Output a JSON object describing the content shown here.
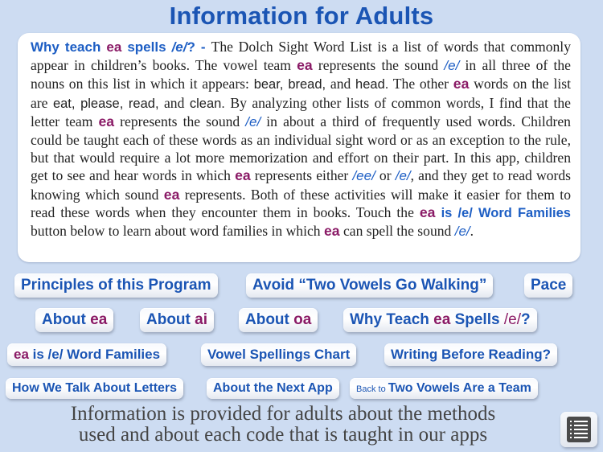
{
  "header": {
    "title": "Information for Adults"
  },
  "article": {
    "lead_a": "Why teach ",
    "lead_ea": "ea",
    "lead_b": " spells ",
    "lead_phon": "/e/",
    "lead_c": "? - ",
    "s1": "The Dolch Sight Word List is a list of words that commonly appear in children’s books. The vowel team ",
    "ea": "ea",
    "s2": " represents the sound ",
    "phon_e": "/e/",
    "s3": " in all three of the nouns on this list in which it appears: ",
    "nouns": "bear, bread,",
    "s4": " and ",
    "noun_head": "head.",
    "s5": " The other ",
    "s6": " words on the list are ",
    "words1": "eat, please, read,",
    "words2": "clean.",
    "s7": " By analyzing other lists of common words, I find that the letter team ",
    "s8": " in about a third of frequently used words. Children could be taught each of these words as an individual sight word or as an exception to the rule, but that would require a lot more memorization and effort on their part. In this app, children get to see and hear words in which ",
    "s9": " represents either ",
    "phon_ee": "/ee/",
    "or": " or ",
    "s10": ", and they get to read words knowing which sound ",
    "s11": " represents. Both of these activities will make it easier for them to read these words when they encounter them in books. Touch the ",
    "btn_ref": " is /e/ Word Families",
    "s12": " button below to learn about word families in which ",
    "s13": " can spell the sound ",
    "end": "."
  },
  "buttons": {
    "principles": "Principles of this Program",
    "avoid": "Avoid “Two Vowels Go Walking”",
    "pace": "Pace",
    "about": "About ",
    "ea": "ea",
    "ai": "ai",
    "oa": "oa",
    "why_a": "Why Teach ",
    "why_b": " Spells ",
    "why_phon": "/e/",
    "why_c": "?",
    "wf_b": " is /e/ Word Families",
    "vowel_chart": "Vowel Spellings Chart",
    "writing": "Writing Before Reading?",
    "letters": "How We Talk About Letters",
    "next_app": "About the Next App",
    "back_small": "Back to ",
    "back_main": "Two Vowels Are a Team"
  },
  "footer": {
    "line1": "Information is provided for adults about the methods",
    "line2": "used and about each code that is taught in our apps"
  },
  "menu": {
    "icon": "list-menu-icon"
  },
  "colors": {
    "background": "#cddcf2",
    "title_blue": "#1b55b4",
    "accent_maroon": "#8a1a66",
    "link_blue": "#1d5ec4"
  }
}
